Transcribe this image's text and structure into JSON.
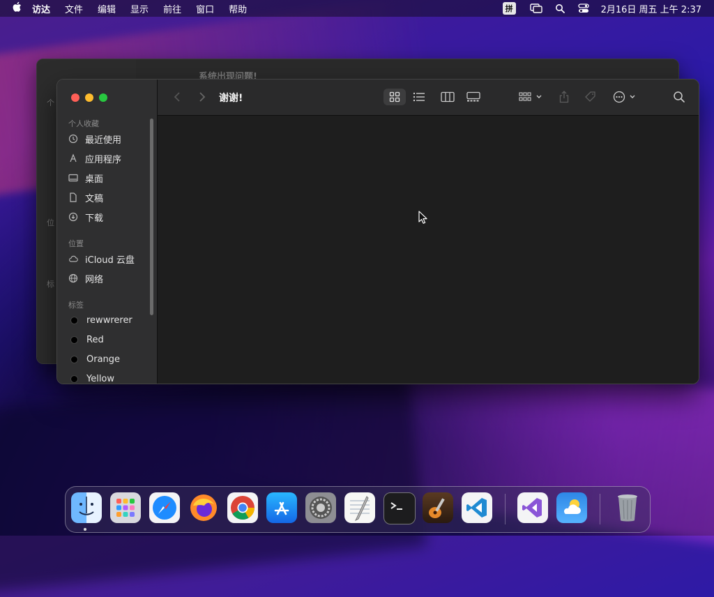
{
  "menubar": {
    "app_name": "访达",
    "menus": [
      "文件",
      "编辑",
      "显示",
      "前往",
      "窗口",
      "帮助"
    ],
    "input_method": "拼",
    "clock": "2月16日 周五 上午 2:37"
  },
  "back_window": {
    "title": "系统出现问题!",
    "side_labels": [
      "个",
      "位",
      "标"
    ]
  },
  "finder": {
    "title": "谢谢!",
    "sidebar": {
      "favorites_header": "个人收藏",
      "favorites": [
        {
          "label": "最近使用",
          "icon": "clock-icon"
        },
        {
          "label": "应用程序",
          "icon": "applications-icon"
        },
        {
          "label": "桌面",
          "icon": "desktop-icon"
        },
        {
          "label": "文稿",
          "icon": "document-icon"
        },
        {
          "label": "下载",
          "icon": "download-icon"
        }
      ],
      "locations_header": "位置",
      "locations": [
        {
          "label": "iCloud 云盘",
          "icon": "cloud-icon"
        },
        {
          "label": "网络",
          "icon": "network-icon"
        }
      ],
      "tags_header": "标签",
      "tags": [
        {
          "label": "rewwrerer"
        },
        {
          "label": "Red"
        },
        {
          "label": "Orange"
        },
        {
          "label": "Yellow"
        }
      ]
    }
  },
  "dock": {
    "apps": [
      "Finder",
      "Launchpad",
      "Safari",
      "Firefox",
      "Chrome",
      "App Store",
      "System Preferences",
      "TextEdit",
      "Terminal",
      "GarageBand",
      "Visual Studio Code",
      "Visual Studio",
      "Weather",
      "Trash"
    ]
  },
  "colors": {
    "close": "#ff5f57",
    "minimize": "#febc2e",
    "maximize": "#28c840"
  }
}
